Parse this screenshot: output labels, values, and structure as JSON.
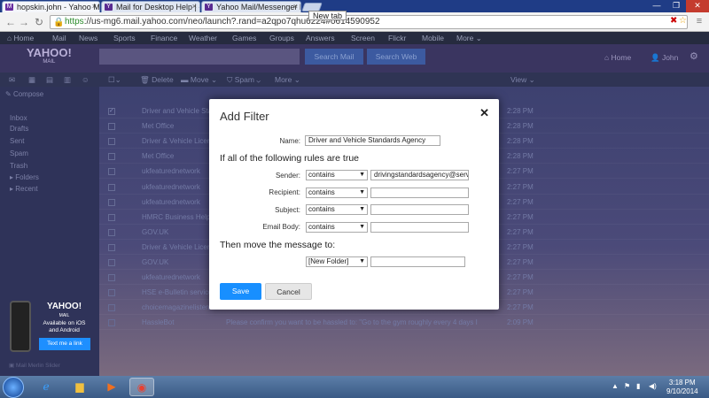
{
  "browser": {
    "tabs": [
      {
        "icon": "M",
        "label": "hopskin.john - Yahoo Mai"
      },
      {
        "icon": "Y",
        "label": "Mail for Desktop Help | - S"
      },
      {
        "icon": "Y",
        "label": "Yahoo Mail/Messenger Re"
      }
    ],
    "new_tab_tooltip": "New tab",
    "url_scheme": "https",
    "url_rest": "://us-mg6.mail.yahoo.com/neo/launch?.rand=a2qpo7qhu6224#0614590952"
  },
  "yahoo": {
    "top_nav": [
      "Home",
      "Mail",
      "News",
      "Sports",
      "Finance",
      "Weather",
      "Games",
      "Groups",
      "Answers",
      "Screen",
      "Flickr",
      "Mobile",
      "More ⌄"
    ],
    "logo": "YAHOO!",
    "logo_sub": "MAIL",
    "search_mail": "Search Mail",
    "search_web": "Search Web",
    "home_link": "Home",
    "user_link": "John",
    "toolbar": {
      "delete": "Delete",
      "move": "Move ⌄",
      "spam": "Spam ⌄",
      "more": "More ⌄",
      "view": "View ⌄"
    },
    "compose": "Compose",
    "folders": [
      "Inbox",
      "Drafts",
      "Sent",
      "Spam",
      "Trash",
      "▸ Folders",
      "▸ Recent"
    ],
    "messages": [
      {
        "from": "Driver and Vehicle Standards",
        "time": "2:28 PM",
        "checked": true
      },
      {
        "from": "Met Office",
        "time": "2:28 PM",
        "checked": false
      },
      {
        "from": "Driver & Vehicle Licen",
        "time": "2:28 PM",
        "checked": false
      },
      {
        "from": "Met Office",
        "time": "2:28 PM",
        "checked": false
      },
      {
        "from": "ukfeaturednetwork",
        "time": "2:27 PM",
        "checked": false
      },
      {
        "from": "ukfeaturednetwork",
        "time": "2:27 PM",
        "checked": false
      },
      {
        "from": "ukfeaturednetwork",
        "time": "2:27 PM",
        "checked": false
      },
      {
        "from": "HMRC Business Help",
        "time": "2:27 PM",
        "checked": false
      },
      {
        "from": "GOV.UK",
        "time": "2:27 PM",
        "checked": false
      },
      {
        "from": "Driver & Vehicle Licen",
        "time": "2:27 PM",
        "checked": false
      },
      {
        "from": "GOV.UK",
        "time": "2:27 PM",
        "checked": false
      },
      {
        "from": "ukfeaturednetwork",
        "time": "2:27 PM",
        "checked": false
      },
      {
        "from": "HSE e-Bulletin service",
        "time": "2:27 PM",
        "checked": false
      },
      {
        "from": "choicemagazinelisten",
        "time": "2:27 PM",
        "checked": false
      },
      {
        "from": "HassleBot",
        "time": "2:09 PM",
        "checked": false
      }
    ],
    "last_preview": "Please confirm you want to be hassled to: \"Go to the gym roughly every 4 days I",
    "promo": {
      "logo": "YAHOO!",
      "sub": "MAIL",
      "line1": "Available on iOS",
      "line2": "and Android",
      "button": "Text me a link"
    },
    "footer": "Mail Merlin Slider"
  },
  "dialog": {
    "title": "Add Filter",
    "name_label": "Name:",
    "name_value": "Driver and Vehicle Standards Agency",
    "rules_heading": "If all of the following rules are true",
    "rules": [
      {
        "label": "Sender:",
        "op": "contains",
        "value": "drivingstandardsagency@servic"
      },
      {
        "label": "Recipient:",
        "op": "contains",
        "value": ""
      },
      {
        "label": "Subject:",
        "op": "contains",
        "value": ""
      },
      {
        "label": "Email Body:",
        "op": "contains",
        "value": ""
      }
    ],
    "move_heading": "Then move the message to:",
    "folder_select": "[New Folder]",
    "folder_value": "",
    "save_label": "Save",
    "cancel_label": "Cancel"
  },
  "taskbar": {
    "time": "3:18 PM",
    "date": "9/10/2014"
  }
}
